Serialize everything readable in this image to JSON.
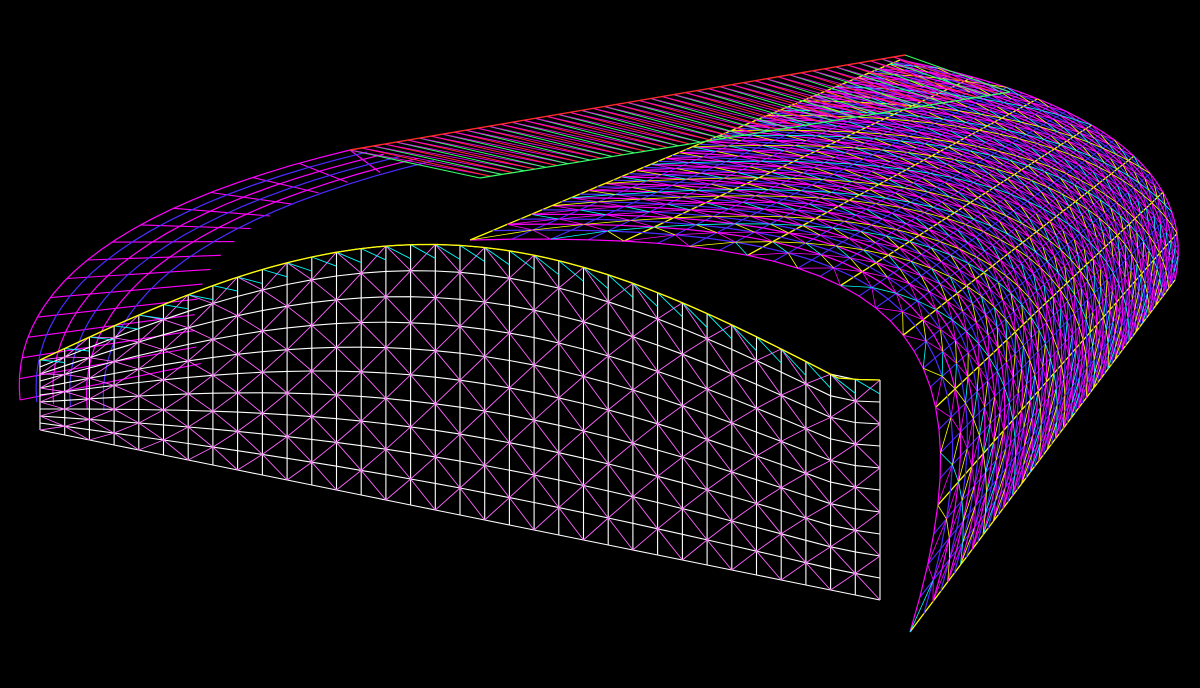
{
  "viewport": {
    "background": "#000000",
    "projection": "perspective",
    "render_mode": "wireframe"
  },
  "model": {
    "kind": "barrel-vault space truss structure",
    "members": [
      {
        "role": "main-arch-ribs",
        "color": "#ff00ff"
      },
      {
        "role": "secondary-ribs",
        "color": "#4d2bff"
      },
      {
        "role": "ridge-and-edge-chords",
        "color": "#ffff00"
      },
      {
        "role": "diagonal-bracing",
        "color": "#00ffff"
      },
      {
        "role": "gable-wall-grid",
        "color": "#ffffff"
      },
      {
        "role": "gable-wall-bracing",
        "color": "#ff66ff"
      },
      {
        "role": "ridge-roof-trusses",
        "color": "#ff2a2a"
      },
      {
        "role": "ridge-roof-trusses-secondary",
        "color": "#33ff66"
      }
    ]
  }
}
